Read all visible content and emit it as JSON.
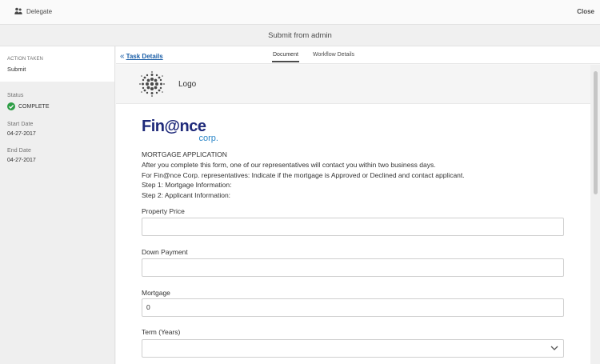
{
  "topbar": {
    "delegate_label": "Delegate",
    "close_label": "Close"
  },
  "title": "Submit from admin",
  "sidebar": {
    "action_taken_label": "ACTION TAKEN",
    "action_taken_value": "Submit",
    "status_label": "Status",
    "status_value": "COMPLETE",
    "start_date_label": "Start Date",
    "start_date_value": "04-27-2017",
    "end_date_label": "End Date",
    "end_date_value": "04-27-2017"
  },
  "tabs": {
    "back_label": "Task Details",
    "items": [
      {
        "label": "Document"
      },
      {
        "label": "Workflow Details"
      }
    ]
  },
  "document": {
    "logo_text": "Logo",
    "brand_main": "Fin@nce",
    "brand_sub": "corp.",
    "intro_lines": [
      "MORTGAGE APPLICATION",
      "After you complete this form, one of our representatives will contact you within two business days.",
      "For Fin@nce Corp. representatives: Indicate if the mortgage is Approved or Declined and contact applicant.",
      "Step 1: Mortgage Information:",
      "Step 2: Applicant Information:"
    ],
    "fields": [
      {
        "label": "Property Price",
        "value": ""
      },
      {
        "label": "Down Payment",
        "value": ""
      },
      {
        "label": "Mortgage",
        "value": "0"
      },
      {
        "label": "Term (Years)",
        "value": ""
      }
    ]
  },
  "colors": {
    "status_green": "#2d9d45",
    "link_blue": "#1a5ea7",
    "brand_navy": "#1f2a7a",
    "brand_blue": "#2b86c8"
  }
}
